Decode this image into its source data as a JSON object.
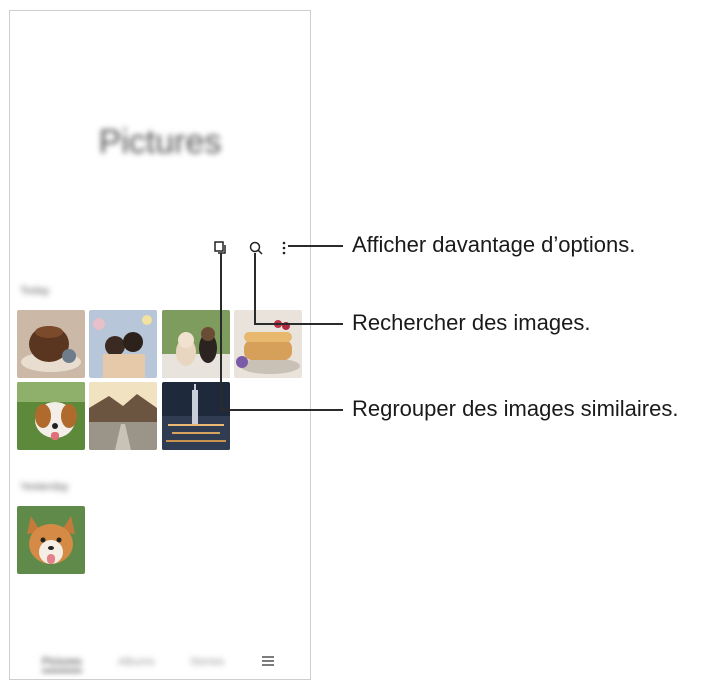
{
  "screen": {
    "title": "Pictures",
    "sections": [
      {
        "label": "Today"
      },
      {
        "label": "Yesterday"
      }
    ],
    "bottom_nav": {
      "tabs": [
        "Pictures",
        "Albums",
        "Stories"
      ],
      "active_tab": "Pictures",
      "menu_icon": "hamburger-menu-icon"
    }
  },
  "toolbar": {
    "icons": [
      "group-similar-icon",
      "search-icon",
      "more-options-icon"
    ]
  },
  "callouts": {
    "more_options": "Afficher davantage d’options.",
    "search": "Rechercher des images.",
    "group_similar": "Regrouper des images similaires."
  },
  "colors": {
    "line": "#2b2b2b",
    "frame": "#cfcfcf"
  }
}
